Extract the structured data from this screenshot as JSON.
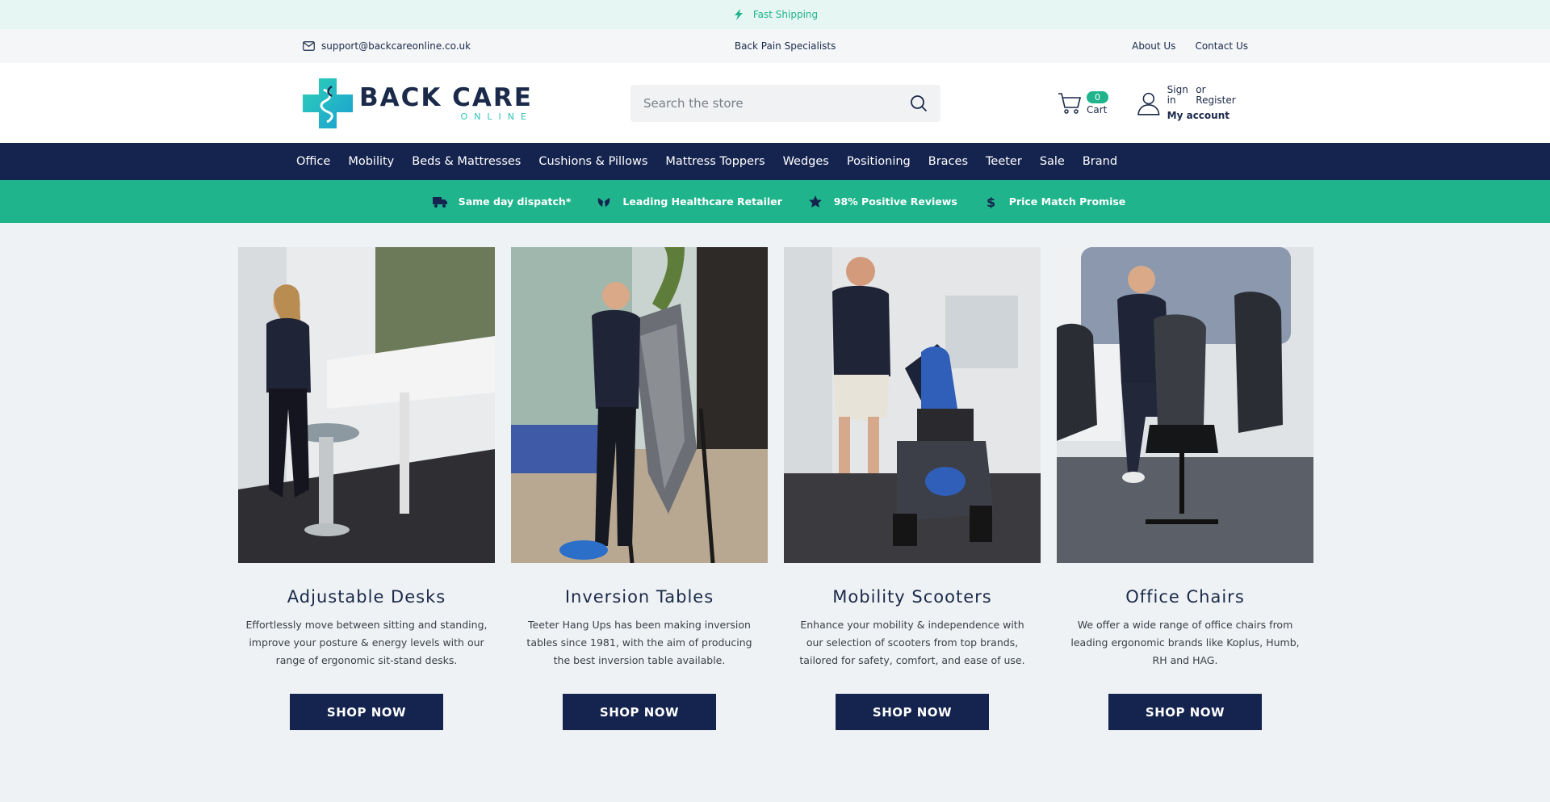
{
  "topbar": {
    "text": "Fast Shipping",
    "icon": "lightning-icon"
  },
  "infobar": {
    "email": "support@backcareonline.co.uk",
    "tagline": "Back Pain Specialists",
    "links": [
      "About Us",
      "Contact Us"
    ]
  },
  "header": {
    "logo_main": "BACK CARE",
    "logo_sub": "ONLINE",
    "search_placeholder": "Search the store",
    "cart_count": "0",
    "cart_label": "Cart",
    "account": {
      "sign_in": "Sign in",
      "or_register": "or Register",
      "my_account": "My account"
    }
  },
  "nav": {
    "items": [
      "Office",
      "Mobility",
      "Beds & Mattresses",
      "Cushions & Pillows",
      "Mattress Toppers",
      "Wedges",
      "Positioning",
      "Braces",
      "Teeter",
      "Sale",
      "Brand"
    ]
  },
  "usp": [
    {
      "text": "Same day dispatch*",
      "icon": "truck-icon"
    },
    {
      "text": "Leading Healthcare Retailer",
      "icon": "hands-icon"
    },
    {
      "text": "98% Positive Reviews",
      "icon": "star-icon"
    },
    {
      "text": "Price Match Promise",
      "icon": "dollar-icon"
    }
  ],
  "cards": [
    {
      "title": "Adjustable Desks",
      "desc": "Effortlessly move between sitting and standing, improve your posture & energy levels with our range of ergonomic sit-stand desks.",
      "button": "SHOP NOW"
    },
    {
      "title": "Inversion Tables",
      "desc": "Teeter Hang Ups has been making inversion tables since 1981, with the aim of producing the best inversion table available.",
      "button": "SHOP NOW"
    },
    {
      "title": "Mobility Scooters",
      "desc": "Enhance your mobility & independence with our selection of scooters from top brands, tailored for safety, comfort, and ease of use.",
      "button": "SHOP NOW"
    },
    {
      "title": "Office Chairs",
      "desc": "We offer a wide range of office chairs from leading ergonomic brands like Koplus, Humb, RH and HAG.",
      "button": "SHOP NOW"
    }
  ],
  "colors": {
    "navy": "#15244f",
    "teal": "#1fb48c",
    "background": "#eef2f4"
  }
}
